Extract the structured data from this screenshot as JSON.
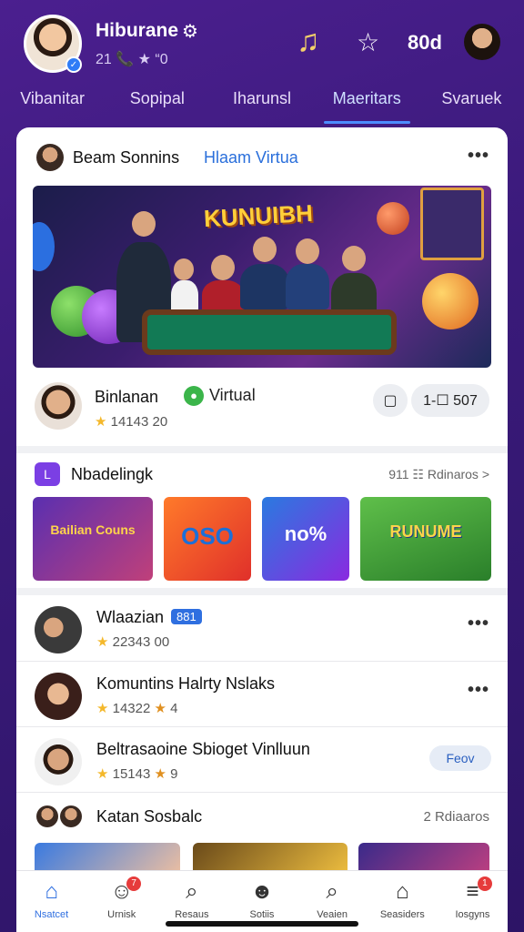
{
  "header": {
    "username": "Hiburane",
    "subline": "21 📞 ★ “0",
    "coins": "80d",
    "colors": {
      "accent": "#4d8dff",
      "background": "#3a1a7a",
      "music_icon": "#f3cf6a"
    },
    "icons": [
      "gear-icon",
      "music-note-icon",
      "star-icon"
    ]
  },
  "tabs": [
    {
      "label": "Vibanitar"
    },
    {
      "label": "Sopipal"
    },
    {
      "label": "Iharunsl"
    },
    {
      "label": "Maeritars",
      "active": true
    },
    {
      "label": "Svaruek"
    }
  ],
  "post": {
    "author": "Beam Sonnins",
    "tag": "Hlaam Virtua",
    "banner_title": "KUNUIBH",
    "host_name": "Binlanan",
    "host_badge": "Virtual",
    "host_stats": "14143 20",
    "pill_count": "1-☐ 507"
  },
  "section": {
    "title": "Nbadelingk",
    "link": "911 ☷ Rdinaros >",
    "thumbnails": [
      {
        "label": "Bailian Couns"
      },
      {
        "label": "OSO"
      },
      {
        "label": "no%"
      },
      {
        "label": "RUNUME"
      }
    ]
  },
  "list": [
    {
      "name": "Wlaazian",
      "badge": "881",
      "stats": "22343 00"
    },
    {
      "name": "Komuntins Halrty Nslaks",
      "stats": "14322",
      "extra": "4"
    },
    {
      "name": "Beltrasaoine Sbioget Vinlluun",
      "stats": "15143",
      "extra": "9",
      "action": "Feov"
    }
  ],
  "strip": {
    "title": "Katan Sosbalc",
    "link": "2 Rdiaaros"
  },
  "bottom_nav": [
    {
      "label": "Nsatcet",
      "icon": "home-icon",
      "active": true
    },
    {
      "label": "Urnisk",
      "icon": "person-icon",
      "badge": "7"
    },
    {
      "label": "Resaus",
      "icon": "search-icon"
    },
    {
      "label": "Sotiis",
      "icon": "face-icon"
    },
    {
      "label": "Veaien",
      "icon": "search-icon"
    },
    {
      "label": "Seasiders",
      "icon": "store-icon"
    },
    {
      "label": "Iosgyns",
      "icon": "menu-icon",
      "badge": "1"
    }
  ]
}
